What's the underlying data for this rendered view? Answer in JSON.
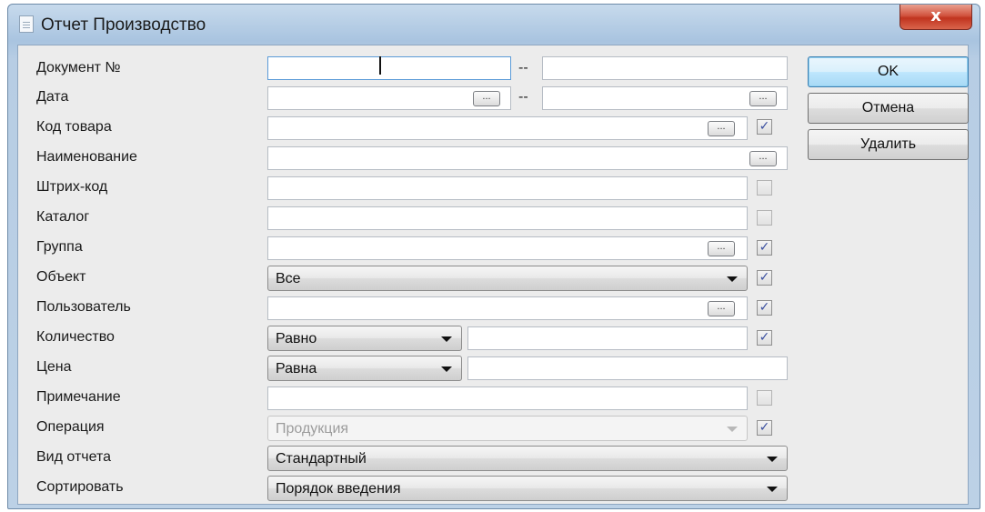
{
  "window": {
    "title": "Отчет Производство",
    "close_glyph": "x"
  },
  "fields": [
    {
      "label": "Документ №",
      "dash": "--"
    },
    {
      "label": "Дата",
      "dash": "--",
      "ellipsis": "..."
    },
    {
      "label": "Код товара",
      "ellipsis": "...",
      "checked": true
    },
    {
      "label": "Наименование",
      "ellipsis": "..."
    },
    {
      "label": "Штрих-код",
      "checked": false
    },
    {
      "label": "Каталог",
      "checked": false
    },
    {
      "label": "Группа",
      "ellipsis": "...",
      "checked": true
    },
    {
      "label": "Объект",
      "value": "Все",
      "checked": true
    },
    {
      "label": "Пользователь",
      "ellipsis": "...",
      "checked": true
    },
    {
      "label": "Количество",
      "operator": "Равно",
      "checked": true
    },
    {
      "label": "Цена",
      "operator": "Равна"
    },
    {
      "label": "Примечание",
      "checked": false
    },
    {
      "label": "Операция",
      "value": "Продукция",
      "disabled": true,
      "checked": true
    },
    {
      "label": "Вид отчета",
      "value": "Стандартный"
    },
    {
      "label": "Сортировать",
      "value": "Порядок введения"
    }
  ],
  "buttons": {
    "ok": "OK",
    "cancel": "Отмена",
    "delete": "Удалить"
  },
  "check_glyph": "✓",
  "colors": {
    "accent": "#3c7fb1",
    "close": "#c0341f"
  }
}
